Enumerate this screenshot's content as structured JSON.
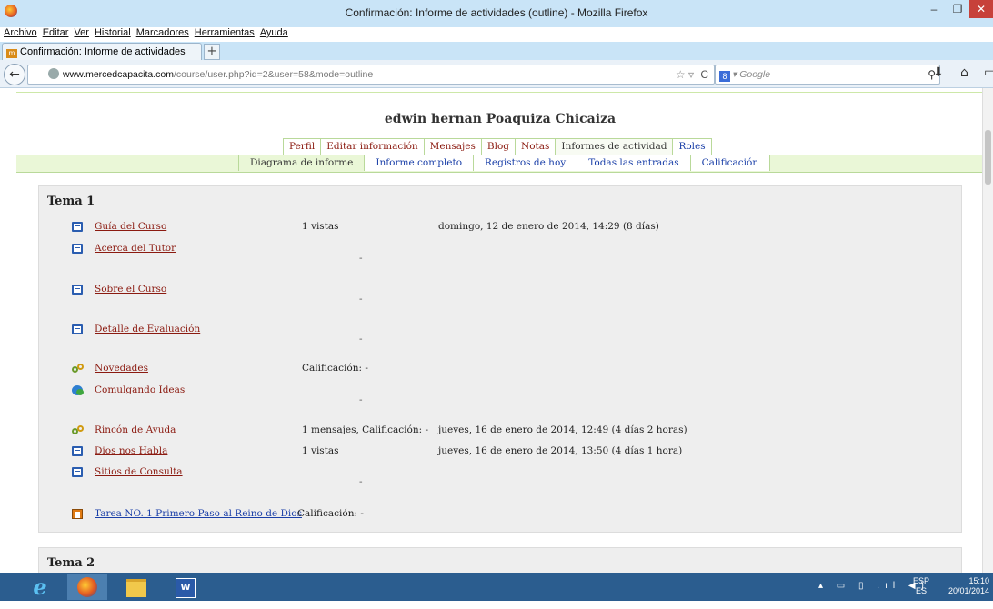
{
  "window": {
    "title": "Confirmación: Informe de actividades (outline) - Mozilla Firefox",
    "min_glyph": "–",
    "max_glyph": "❐",
    "close_glyph": "✕"
  },
  "menu": [
    "Archivo",
    "Editar",
    "Ver",
    "Historial",
    "Marcadores",
    "Herramientas",
    "Ayuda"
  ],
  "tab": {
    "label": "Confirmación: Informe de actividades (o...",
    "favicon": "m",
    "new_tab": "+"
  },
  "nav": {
    "back_glyph": "←",
    "url_host": "www.mercedcapacita.com",
    "url_path": "/course/user.php?id=2&user=58&mode=outline",
    "star_glyph": "☆ ▿",
    "reload_glyph": "C",
    "search_engine": "8",
    "search_placeholder": "▾ Google",
    "search_glyph": "⚲",
    "download_glyph": "⬇",
    "home_glyph": "⌂",
    "extra_glyph": "▭"
  },
  "profile": {
    "name": "edwin hernan Poaquiza Chicaiza",
    "tabs": [
      {
        "label": "Perfil"
      },
      {
        "label": "Editar información"
      },
      {
        "label": "Mensajes"
      },
      {
        "label": "Blog"
      },
      {
        "label": "Notas"
      },
      {
        "label": "Informes de actividad",
        "active": true
      },
      {
        "label": "Roles"
      }
    ],
    "subtabs": [
      {
        "label": "Diagrama de informe",
        "active": true
      },
      {
        "label": "Informe completo"
      },
      {
        "label": "Registros de hoy"
      },
      {
        "label": "Todas las entradas"
      },
      {
        "label": "Calificación"
      }
    ]
  },
  "sections": [
    {
      "title": "Tema 1",
      "items": [
        {
          "icon": "page-icon",
          "name": "Guía del Curso",
          "info": "1 vistas",
          "date": "domingo, 12 de enero de 2014, 14:29 (8 días)"
        },
        {
          "icon": "page-icon",
          "name": "Acerca del Tutor",
          "info": "",
          "date": "",
          "dash": "-"
        },
        {
          "icon": "page-icon",
          "name": "Sobre el Curso",
          "info": "",
          "date": "",
          "dash": "-"
        },
        {
          "icon": "page-icon",
          "name": "Detalle de Evaluación",
          "info": "",
          "date": "",
          "dash": "-"
        },
        {
          "icon": "forum-icon",
          "name": "Novedades",
          "info": "Calificación: -",
          "date": ""
        },
        {
          "icon": "chat-icon",
          "name": "Comulgando Ideas",
          "info": "",
          "date": "",
          "dash": "-"
        },
        {
          "icon": "forum-icon",
          "name": "Rincón de Ayuda",
          "info": "1 mensajes, Calificación: -",
          "date": "jueves, 16 de enero de 2014, 12:49 (4 días 2 horas)"
        },
        {
          "icon": "page-icon",
          "name": "Dios nos Habla",
          "info": "1 vistas",
          "date": "jueves, 16 de enero de 2014, 13:50 (4 días 1 hora)"
        },
        {
          "icon": "page-icon",
          "name": "Sitios de Consulta",
          "info": "",
          "date": "",
          "dash": "-"
        },
        {
          "icon": "assignment-icon",
          "name": "Tarea NO. 1 Primero Paso al Reino de Dios",
          "info": "Calificación: -",
          "date": ""
        }
      ]
    },
    {
      "title": "Tema 2",
      "items": []
    }
  ],
  "taskbar": {
    "ie_glyph": "e",
    "word_glyph": "W",
    "tray_icons": "▴ ▭ ▯ .ıl ◀)",
    "lang_top": "ESP",
    "lang_bottom": "ES",
    "time": "15:10",
    "date": "20/01/2014"
  }
}
